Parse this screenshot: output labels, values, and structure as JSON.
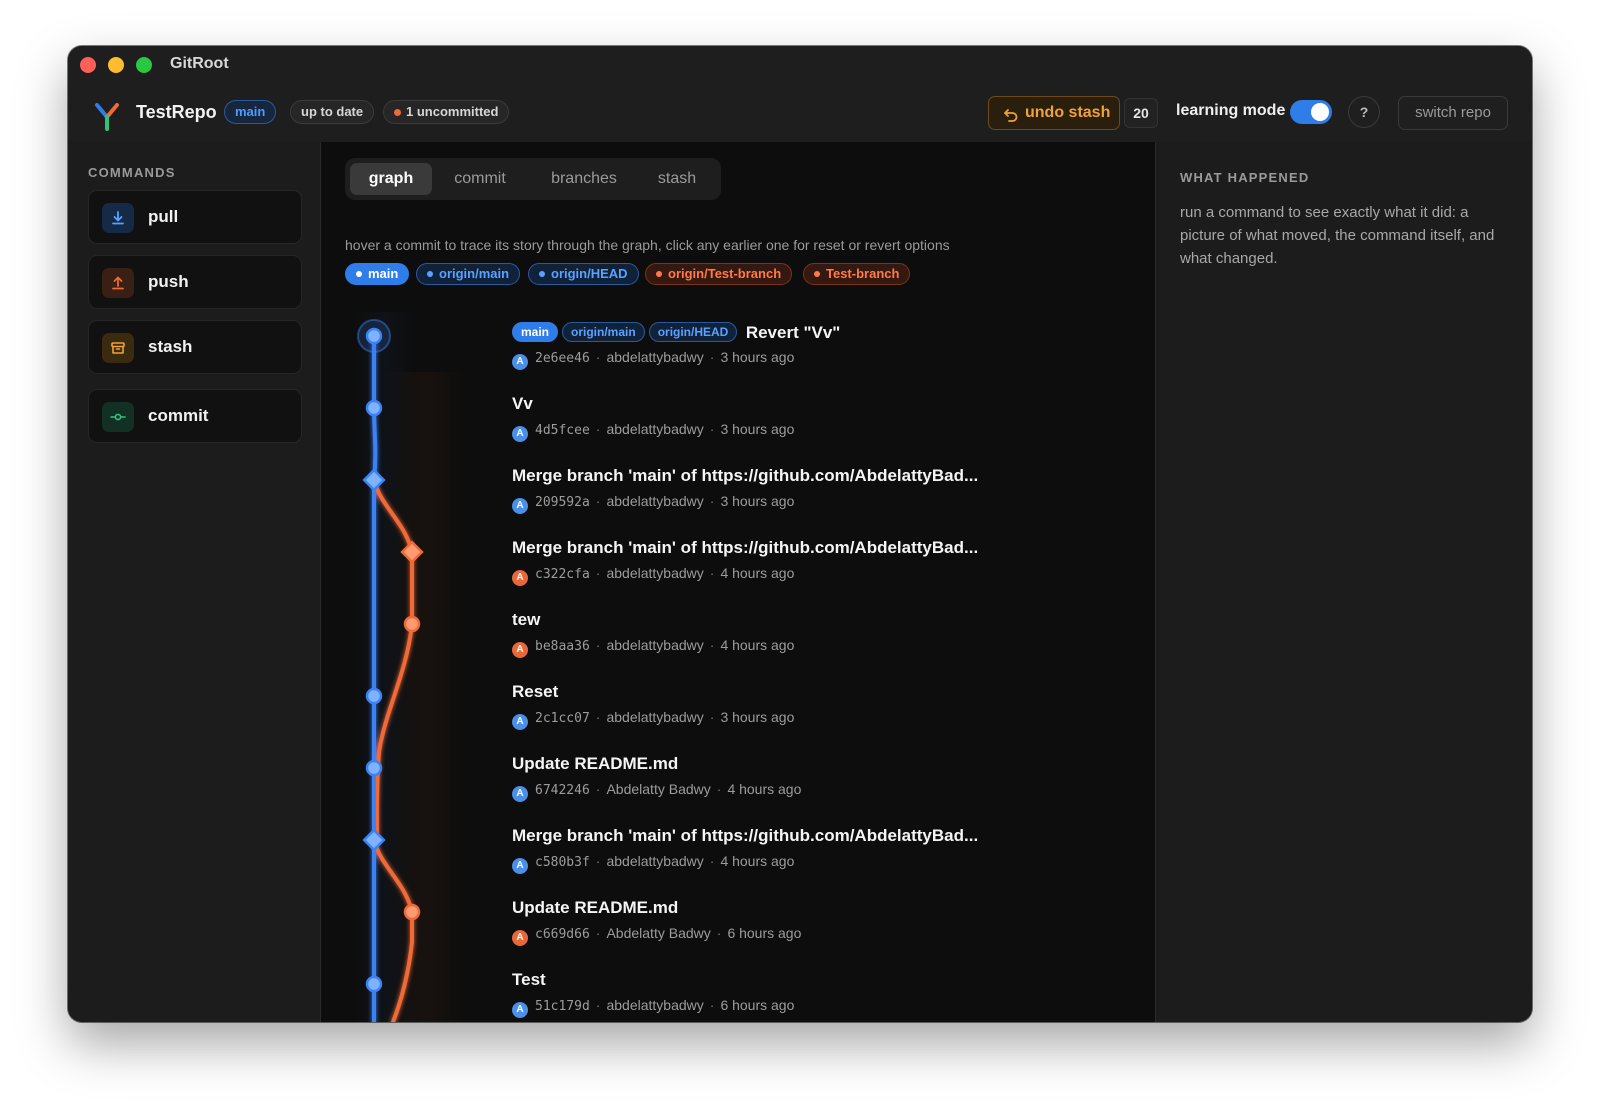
{
  "window": {
    "title": "GitRoot"
  },
  "header": {
    "repo_name": "TestRepo",
    "branch": "main",
    "sync_status": "up to date",
    "uncommitted": "1 uncommitted",
    "undo_label": "undo stash",
    "count": "20",
    "learning_mode_label": "learning mode",
    "learning_mode_on": true,
    "help_label": "?",
    "switch_repo_label": "switch repo"
  },
  "sidebar": {
    "title": "COMMANDS",
    "commands": [
      {
        "label": "pull",
        "icon": "download-icon"
      },
      {
        "label": "push",
        "icon": "upload-icon"
      },
      {
        "label": "stash",
        "icon": "archive-icon"
      },
      {
        "label": "commit",
        "icon": "commit-icon"
      }
    ]
  },
  "main": {
    "tabs": [
      {
        "label": "graph",
        "active": true
      },
      {
        "label": "commit",
        "active": false
      },
      {
        "label": "branches",
        "active": false
      },
      {
        "label": "stash",
        "active": false
      }
    ],
    "hint": "hover a commit to trace its story through the graph, click any earlier one for reset or revert options",
    "refs": [
      "main",
      "origin/main",
      "origin/HEAD",
      "origin/Test-branch",
      "Test-branch"
    ],
    "commits": [
      {
        "message": "Revert \"Vv\"",
        "refs": [
          "main",
          "origin/main",
          "origin/HEAD"
        ],
        "avatar": "A",
        "hash": "2e6ee46",
        "author": "abdelattybadwy",
        "time": "3 hours ago",
        "lane": "blue",
        "node": "head"
      },
      {
        "message": "Vv",
        "avatar": "A",
        "hash": "4d5fcee",
        "author": "abdelattybadwy",
        "time": "3 hours ago",
        "lane": "blue",
        "node": "circle"
      },
      {
        "message": "Merge branch 'main' of https://github.com/AbdelattyBad...",
        "avatar": "A",
        "hash": "209592a",
        "author": "abdelattybadwy",
        "time": "3 hours ago",
        "lane": "blue",
        "node": "diamond"
      },
      {
        "message": "Merge branch 'main' of https://github.com/AbdelattyBad...",
        "avatar": "A",
        "hash": "c322cfa",
        "author": "abdelattybadwy",
        "time": "4 hours ago",
        "lane": "orange",
        "node": "diamond"
      },
      {
        "message": "tew",
        "avatar": "A",
        "hash": "be8aa36",
        "author": "abdelattybadwy",
        "time": "4 hours ago",
        "lane": "orange",
        "node": "circle"
      },
      {
        "message": "Reset",
        "avatar": "A",
        "hash": "2c1cc07",
        "author": "abdelattybadwy",
        "time": "3 hours ago",
        "lane": "blue",
        "node": "circle"
      },
      {
        "message": "Update README.md",
        "avatar": "A",
        "hash": "6742246",
        "author": "Abdelatty Badwy",
        "time": "4 hours ago",
        "lane": "blue",
        "node": "circle"
      },
      {
        "message": "Merge branch 'main' of https://github.com/AbdelattyBad...",
        "avatar": "A",
        "hash": "c580b3f",
        "author": "abdelattybadwy",
        "time": "4 hours ago",
        "lane": "blue",
        "node": "diamond"
      },
      {
        "message": "Update README.md",
        "avatar": "A",
        "hash": "c669d66",
        "author": "Abdelatty Badwy",
        "time": "6 hours ago",
        "lane": "orange",
        "node": "circle"
      },
      {
        "message": "Test",
        "avatar": "A",
        "hash": "51c179d",
        "author": "abdelattybadwy",
        "time": "6 hours ago",
        "lane": "blue",
        "node": "circle"
      }
    ]
  },
  "right_panel": {
    "title": "WHAT HAPPENED",
    "body": "run a command to see exactly what it did: a picture of what moved, the command itself, and what changed."
  },
  "colors": {
    "accent_blue": "#2f7de8",
    "lane_blue": "#3b82f6",
    "lane_orange": "#f06a37",
    "warning_amber": "#f0a236",
    "background": "#0d0d0d"
  }
}
